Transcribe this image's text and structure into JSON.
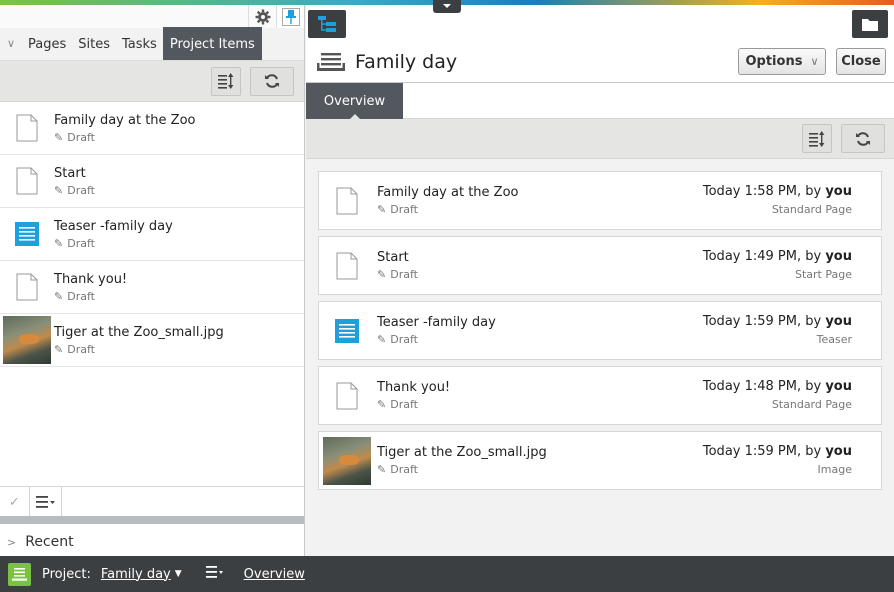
{
  "left_panel": {
    "tabs": [
      {
        "label": "Pages"
      },
      {
        "label": "Sites"
      },
      {
        "label": "Tasks"
      },
      {
        "label": "Project Items"
      }
    ],
    "active_tab": "Project Items",
    "items": [
      {
        "name": "Family day at the Zoo",
        "status": "Draft",
        "icon": "page-icon"
      },
      {
        "name": "Start",
        "status": "Draft",
        "icon": "page-icon"
      },
      {
        "name": "Teaser -family day",
        "status": "Draft",
        "icon": "teaser-block-icon"
      },
      {
        "name": "Thank you!",
        "status": "Draft",
        "icon": "page-icon"
      },
      {
        "name": "Tiger at the Zoo_small.jpg",
        "status": "Draft",
        "icon": "image-thumbnail"
      }
    ],
    "recent_label": "Recent"
  },
  "main": {
    "title": "Family day",
    "options_label": "Options",
    "close_label": "Close",
    "tab_overview": "Overview",
    "cards": [
      {
        "name": "Family day at the Zoo",
        "status": "Draft",
        "time": "Today 1:58 PM, by ",
        "user": "you",
        "type": "Standard Page",
        "icon": "page-icon"
      },
      {
        "name": "Start",
        "status": "Draft",
        "time": "Today 1:49 PM, by ",
        "user": "you",
        "type": "Start Page",
        "icon": "page-icon"
      },
      {
        "name": "Teaser -family day",
        "status": "Draft",
        "time": "Today 1:59 PM, by ",
        "user": "you",
        "type": "Teaser",
        "icon": "teaser-block-icon"
      },
      {
        "name": "Thank you!",
        "status": "Draft",
        "time": "Today 1:48 PM, by ",
        "user": "you",
        "type": "Standard Page",
        "icon": "page-icon"
      },
      {
        "name": "Tiger at the Zoo_small.jpg",
        "status": "Draft",
        "time": "Today 1:59 PM, by ",
        "user": "you",
        "type": "Image",
        "icon": "image-thumbnail"
      }
    ]
  },
  "bottom_bar": {
    "project_label": "Project:",
    "project_name": "Family day",
    "overview_link": "Overview"
  },
  "colors": {
    "accent_blue": "#1ea0dc",
    "dark_bar": "#3b3f42",
    "tab_active": "#52585e",
    "project_green": "#7cc242"
  }
}
